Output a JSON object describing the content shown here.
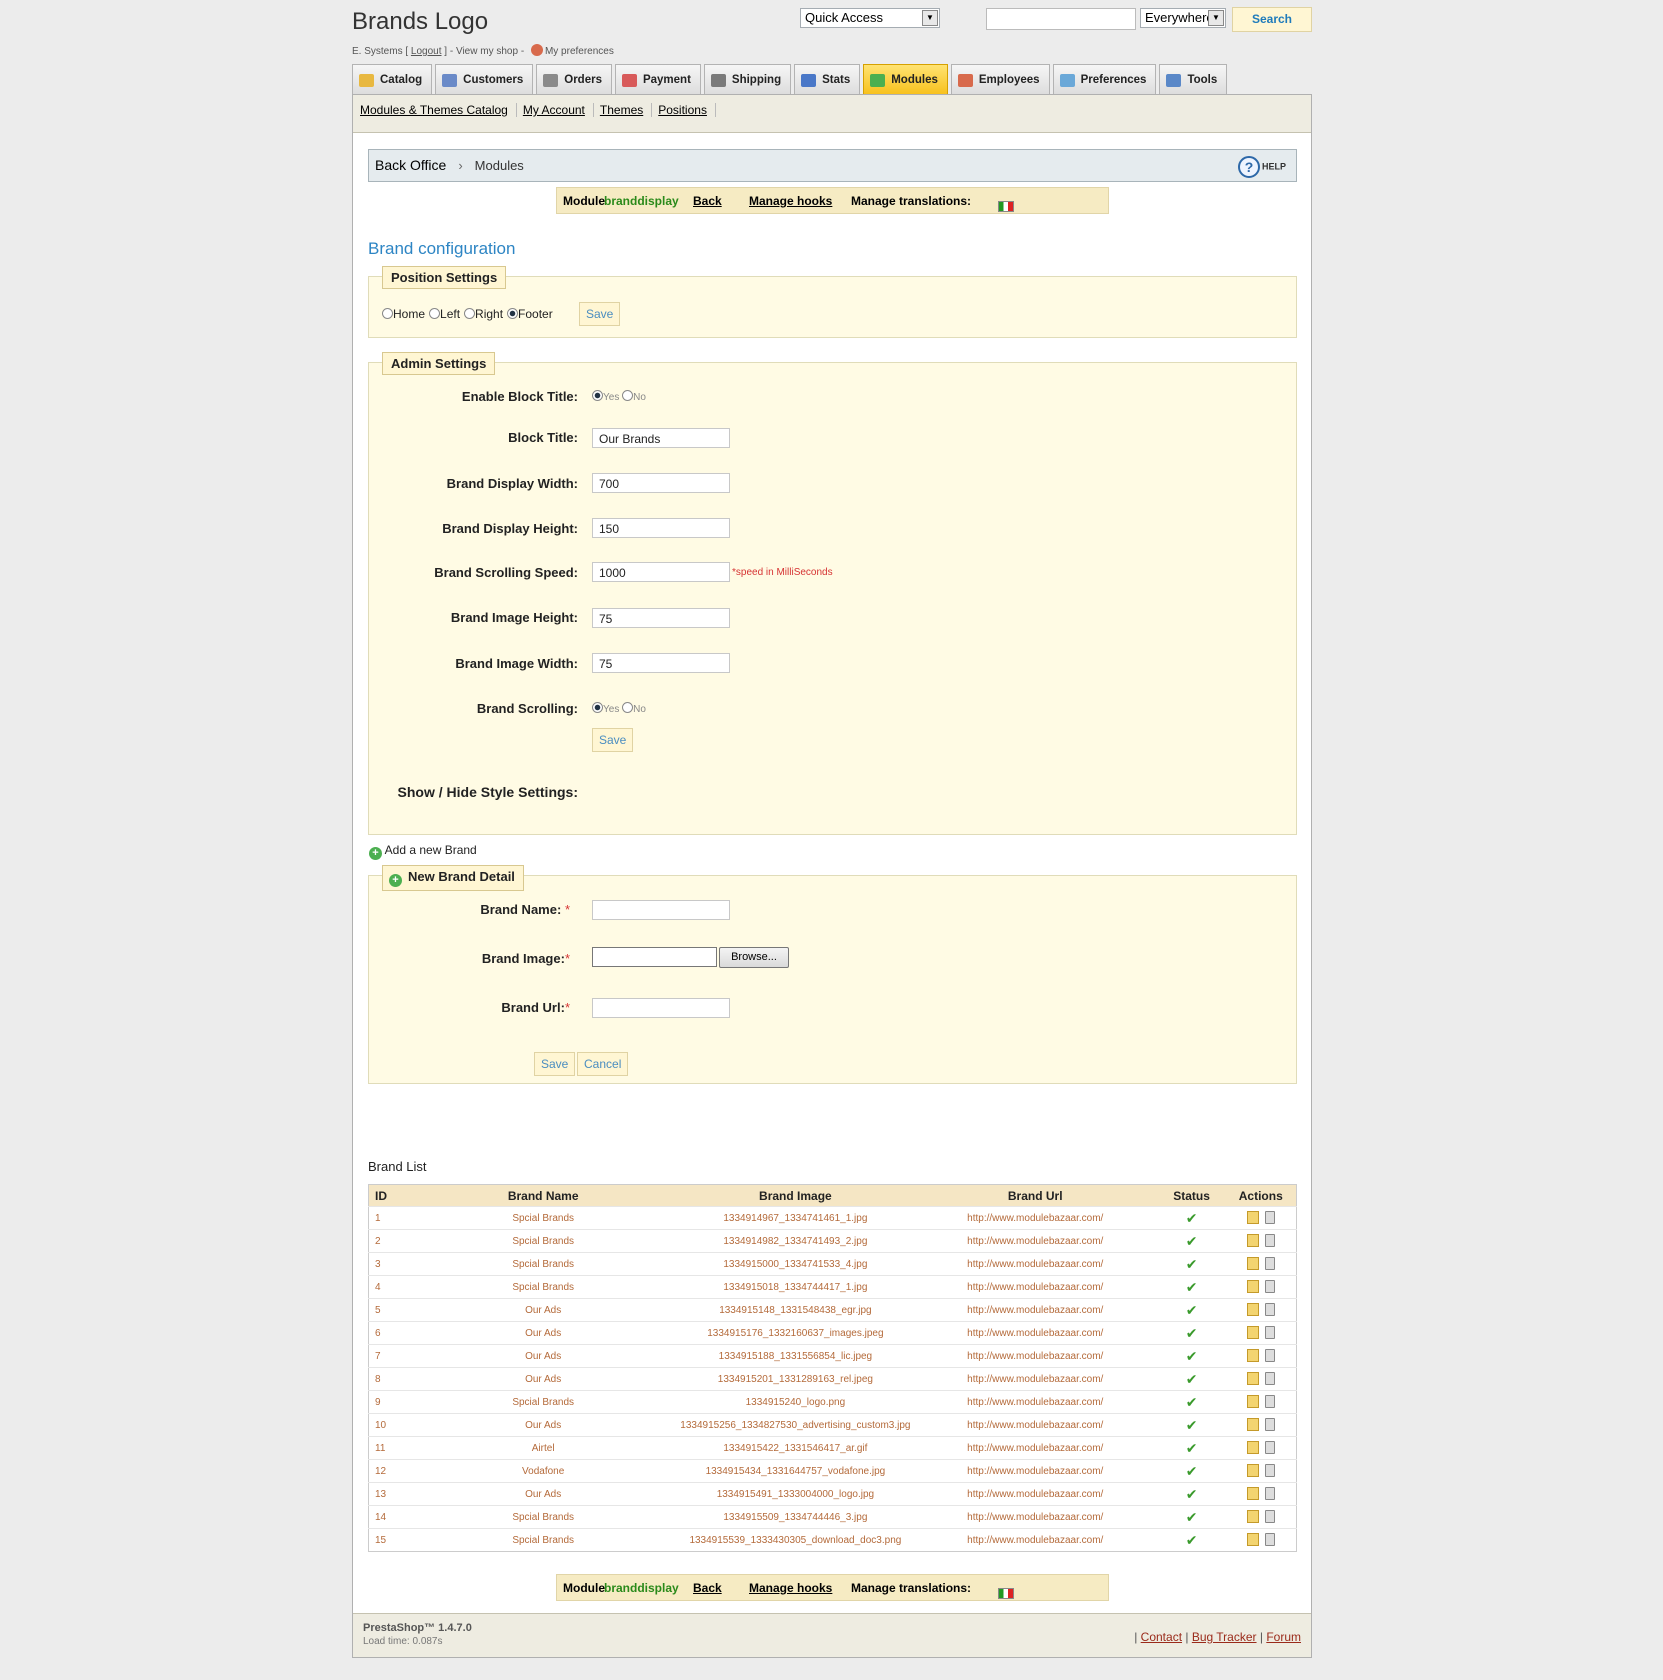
{
  "header": {
    "logo": "Brands Logo",
    "user": "E. Systems",
    "logout": "Logout",
    "view_shop": "View my shop",
    "preferences": "My preferences",
    "quick_access": "Quick Access",
    "search_scope": "Everywhere",
    "search_button": "Search"
  },
  "tabs": [
    {
      "label": "Catalog",
      "icon": "folder-icon",
      "color": "#e8b840"
    },
    {
      "label": "Customers",
      "icon": "customer-icon",
      "color": "#6a8ac8"
    },
    {
      "label": "Orders",
      "icon": "cart-icon",
      "color": "#8a8a8a"
    },
    {
      "label": "Payment",
      "icon": "payment-icon",
      "color": "#d85a5a"
    },
    {
      "label": "Shipping",
      "icon": "truck-icon",
      "color": "#7a7a7a"
    },
    {
      "label": "Stats",
      "icon": "chart-icon",
      "color": "#4a78c8"
    },
    {
      "label": "Modules",
      "icon": "puzzle-icon",
      "color": "#4caf50",
      "active": true
    },
    {
      "label": "Employees",
      "icon": "employee-icon",
      "color": "#d86a4c"
    },
    {
      "label": "Preferences",
      "icon": "preferences-icon",
      "color": "#6aa8d8"
    },
    {
      "label": "Tools",
      "icon": "wrench-icon",
      "color": "#5a88c8"
    }
  ],
  "subnav": [
    "Modules & Themes Catalog",
    "My Account",
    "Themes",
    "Positions"
  ],
  "breadcrumb": {
    "root": "Back Office",
    "current": "Modules",
    "help": "HELP"
  },
  "module_bar": {
    "prefix": "Module",
    "module_name": "branddisplay",
    "back": "Back",
    "manage_hooks": "Manage hooks",
    "translations": "Manage translations:"
  },
  "page_title": "Brand configuration",
  "position_settings": {
    "legend": "Position Settings",
    "options": [
      {
        "label": "Home",
        "checked": false
      },
      {
        "label": "Left",
        "checked": false
      },
      {
        "label": "Right",
        "checked": false
      },
      {
        "label": "Footer",
        "checked": true
      }
    ],
    "save": "Save"
  },
  "admin_settings": {
    "legend": "Admin Settings",
    "enable_block_title": "Enable Block Title:",
    "block_title_label": "Block Title:",
    "block_title_value": "Our Brands",
    "width_label": "Brand Display Width:",
    "width_value": "700",
    "height_label": "Brand Display Height:",
    "height_value": "150",
    "speed_label": "Brand Scrolling Speed:",
    "speed_value": "1000",
    "speed_hint": "*speed in MilliSeconds",
    "img_height_label": "Brand Image Height:",
    "img_height_value": "75",
    "img_width_label": "Brand Image Width:",
    "img_width_value": "75",
    "scrolling_label": "Brand Scrolling:",
    "yes": "Yes",
    "no": "No",
    "save": "Save",
    "style_settings": "Show / Hide Style Settings:"
  },
  "add_brand_link": "Add a new Brand",
  "new_brand": {
    "legend": "New Brand Detail",
    "name_label": "Brand Name:",
    "image_label": "Brand Image:",
    "browse": "Browse...",
    "url_label": "Brand Url:",
    "save": "Save",
    "cancel": "Cancel"
  },
  "brand_list": {
    "title": "Brand List",
    "columns": [
      "ID",
      "Brand Name",
      "Brand Image",
      "Brand Url",
      "Status",
      "Actions"
    ],
    "rows": [
      [
        "1",
        "Spcial Brands",
        "1334914967_1334741461_1.jpg",
        "http://www.modulebazaar.com/"
      ],
      [
        "2",
        "Spcial Brands",
        "1334914982_1334741493_2.jpg",
        "http://www.modulebazaar.com/"
      ],
      [
        "3",
        "Spcial Brands",
        "1334915000_1334741533_4.jpg",
        "http://www.modulebazaar.com/"
      ],
      [
        "4",
        "Spcial Brands",
        "1334915018_1334744417_1.jpg",
        "http://www.modulebazaar.com/"
      ],
      [
        "5",
        "Our Ads",
        "1334915148_1331548438_egr.jpg",
        "http://www.modulebazaar.com/"
      ],
      [
        "6",
        "Our Ads",
        "1334915176_1332160637_images.jpeg",
        "http://www.modulebazaar.com/"
      ],
      [
        "7",
        "Our Ads",
        "1334915188_1331556854_lic.jpeg",
        "http://www.modulebazaar.com/"
      ],
      [
        "8",
        "Our Ads",
        "1334915201_1331289163_rel.jpeg",
        "http://www.modulebazaar.com/"
      ],
      [
        "9",
        "Spcial Brands",
        "1334915240_logo.png",
        "http://www.modulebazaar.com/"
      ],
      [
        "10",
        "Our Ads",
        "1334915256_1334827530_advertising_custom3.jpg",
        "http://www.modulebazaar.com/"
      ],
      [
        "11",
        "Airtel",
        "1334915422_1331546417_ar.gif",
        "http://www.modulebazaar.com/"
      ],
      [
        "12",
        "Vodafone",
        "1334915434_1331644757_vodafone.jpg",
        "http://www.modulebazaar.com/"
      ],
      [
        "13",
        "Our Ads",
        "1334915491_1333004000_logo.jpg",
        "http://www.modulebazaar.com/"
      ],
      [
        "14",
        "Spcial Brands",
        "1334915509_1334744446_3.jpg",
        "http://www.modulebazaar.com/"
      ],
      [
        "15",
        "Spcial Brands",
        "1334915539_1333430305_download_doc3.png",
        "http://www.modulebazaar.com/"
      ]
    ]
  },
  "footer": {
    "version": "PrestaShop™ 1.4.7.0",
    "load_time": "Load time: 0.087s",
    "links": [
      "Contact",
      "Bug Tracker",
      "Forum"
    ]
  },
  "colors": {
    "accent": "#2d85c4",
    "active_tab": "#f7c01b",
    "panel": "#fffbe4"
  }
}
